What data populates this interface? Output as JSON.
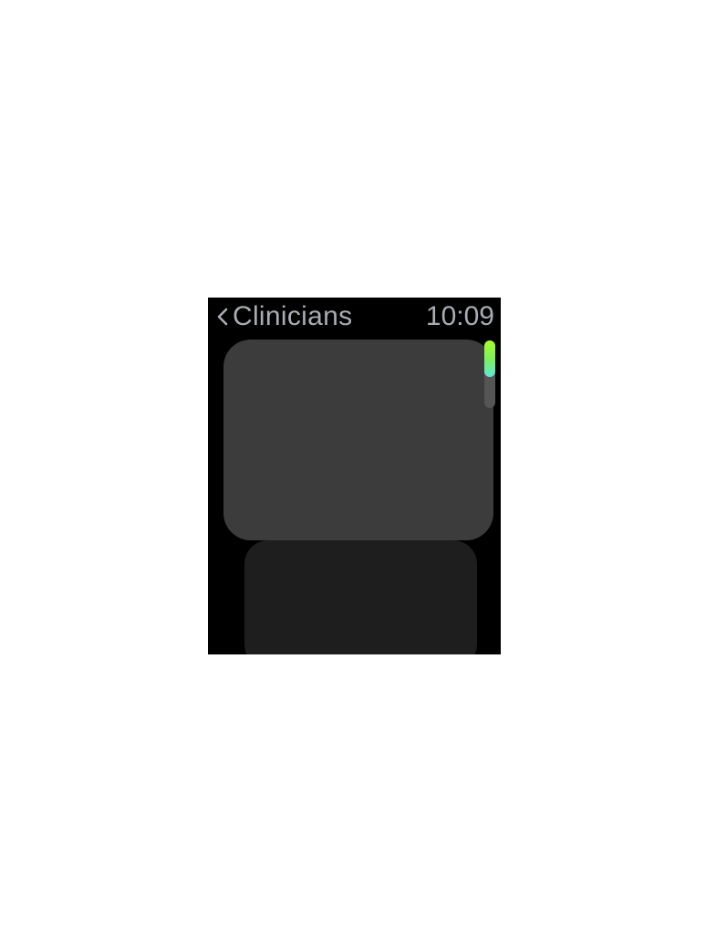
{
  "header": {
    "back_label": "Clinicians",
    "time": "10:09"
  },
  "icons": {
    "back": "chevron-left-icon"
  },
  "scroll": {
    "position_fraction": 0.0,
    "visible_fraction": 0.54
  },
  "colors": {
    "background": "#000000",
    "header_text": "#a9acb2",
    "card_primary": "#3c3c3c",
    "card_secondary": "#1e1e1e",
    "scroll_thumb_top": "#a6ff2e",
    "scroll_thumb_bottom": "#5ee8d8"
  }
}
